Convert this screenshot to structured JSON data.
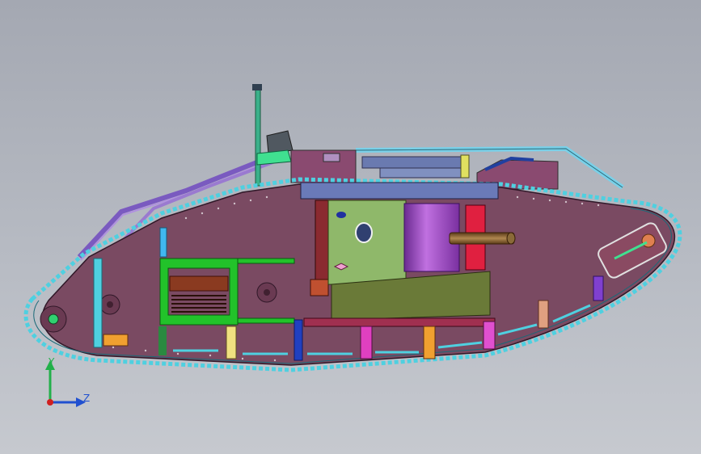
{
  "scene": {
    "colors": {
      "background_top": "#a4a8b2",
      "background_bottom": "#c6c9cf",
      "hull": "#7a4a62",
      "track": "#4fd0e0",
      "door": "#8fb86a",
      "sponson_green": "#22c22a",
      "gun_barrel": "#7a5a30",
      "cylinder": "#9a40c0",
      "exhaust": "#8b6ad0"
    }
  },
  "triad": {
    "y_label": "Y",
    "z_label": "Z",
    "y_color": "#22b04a",
    "z_color": "#2050d0",
    "x_color": "#d02020"
  }
}
